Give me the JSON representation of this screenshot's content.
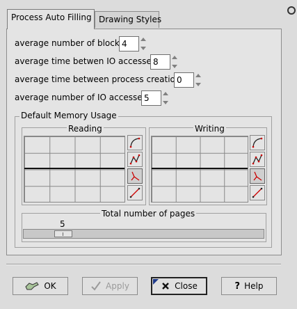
{
  "tabs": [
    {
      "label": "Process Auto Filling",
      "active": true
    },
    {
      "label": "Drawing Styles",
      "active": false
    }
  ],
  "settings": {
    "avg_blocks": {
      "label": "average number of blocks",
      "value": "4"
    },
    "avg_io_time": {
      "label": "average time betwen IO accesses",
      "value": "8"
    },
    "avg_creation_time": {
      "label": "average time between process creation",
      "value": "0"
    },
    "avg_io_count": {
      "label": "average number of IO accesses",
      "value": "5"
    }
  },
  "memory": {
    "title": "Default Memory Usage",
    "reading_label": "Reading",
    "writing_label": "Writing",
    "curve_icons": [
      "curve-rising-icon",
      "curve-wave-icon",
      "curve-falling-icon",
      "curve-linear-icon"
    ]
  },
  "pages": {
    "title": "Total number of pages",
    "value": "5",
    "fraction": 0.14
  },
  "buttons": {
    "ok": "OK",
    "apply": "Apply",
    "close": "Close",
    "help": "Help"
  },
  "colors": {
    "accent": "#cc0000",
    "panel": "#e4e4e4"
  }
}
